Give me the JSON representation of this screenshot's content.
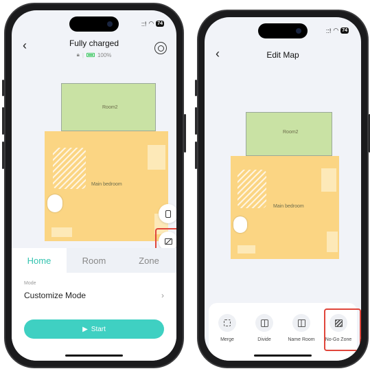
{
  "left_screen": {
    "status": {
      "signal": "::!",
      "wifi": "◠",
      "battery": "74"
    },
    "header": {
      "title": "Fully charged",
      "battery_percent": "100%"
    },
    "map": {
      "room_top": "Room2",
      "room_main": "Main bedroom"
    },
    "tabs": [
      {
        "label": "Home",
        "active": true
      },
      {
        "label": "Room",
        "active": false
      },
      {
        "label": "Zone",
        "active": false
      }
    ],
    "mode": {
      "label": "Mode",
      "value": "Customize Mode"
    },
    "start_label": "Start"
  },
  "right_screen": {
    "status": {
      "signal": "::!",
      "wifi": "◠",
      "battery": "74"
    },
    "header": {
      "title": "Edit Map"
    },
    "map": {
      "room_top": "Room2",
      "room_main": "Main bedroom"
    },
    "tools": [
      {
        "label": "Merge",
        "icon": "merge-icon"
      },
      {
        "label": "Divide",
        "icon": "divide-icon"
      },
      {
        "label": "Name Room",
        "icon": "name-room-icon"
      },
      {
        "label": "No-Go Zone",
        "icon": "no-go-zone-icon"
      }
    ]
  },
  "colors": {
    "accent": "#3fd0c2",
    "highlight": "#e0453a",
    "room2": "#c9e2a4",
    "bedroom": "#fbd583"
  }
}
